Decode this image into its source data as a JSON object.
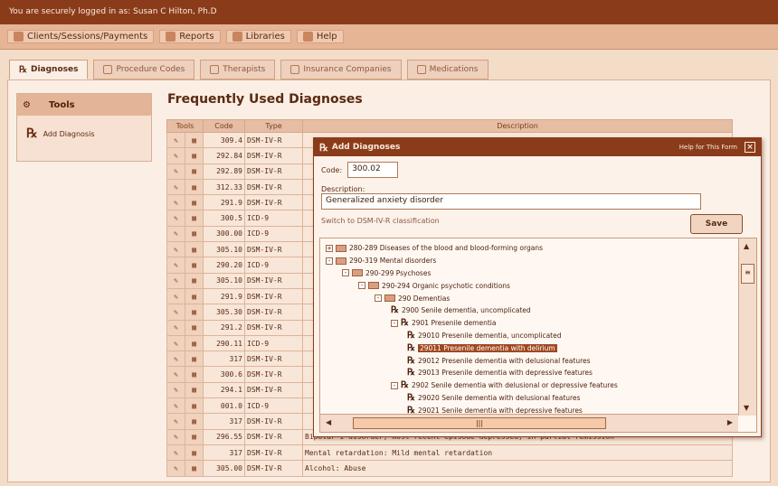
{
  "login_bar": "You are securely logged in as: Susan C Hilton, Ph.D",
  "menu": [
    "Clients/Sessions/Payments",
    "Reports",
    "Libraries",
    "Help"
  ],
  "tabs": [
    "Diagnoses",
    "Procedure Codes",
    "Therapists",
    "Insurance Companies",
    "Medications"
  ],
  "tools": {
    "title": "Tools",
    "add_label": "Add Diagnosis"
  },
  "frequent_title": "Frequently Used Diagnoses",
  "grid": {
    "headers": [
      "Tools",
      "Code",
      "Type",
      "Description"
    ],
    "rows": [
      {
        "code": "309.4",
        "type": "DSM-IV-R",
        "desc": ""
      },
      {
        "code": "292.84",
        "type": "DSM-IV-R",
        "desc": ""
      },
      {
        "code": "292.89",
        "type": "DSM-IV-R",
        "desc": ""
      },
      {
        "code": "312.33",
        "type": "DSM-IV-R",
        "desc": ""
      },
      {
        "code": "291.9",
        "type": "DSM-IV-R",
        "desc": ""
      },
      {
        "code": "300.5",
        "type": "ICD-9",
        "desc": ""
      },
      {
        "code": "300.00",
        "type": "ICD-9",
        "desc": ""
      },
      {
        "code": "305.10",
        "type": "DSM-IV-R",
        "desc": ""
      },
      {
        "code": "290.20",
        "type": "ICD-9",
        "desc": ""
      },
      {
        "code": "305.10",
        "type": "DSM-IV-R",
        "desc": ""
      },
      {
        "code": "291.9",
        "type": "DSM-IV-R",
        "desc": ""
      },
      {
        "code": "305.30",
        "type": "DSM-IV-R",
        "desc": ""
      },
      {
        "code": "291.2",
        "type": "DSM-IV-R",
        "desc": ""
      },
      {
        "code": "290.11",
        "type": "ICD-9",
        "desc": ""
      },
      {
        "code": "317",
        "type": "DSM-IV-R",
        "desc": ""
      },
      {
        "code": "300.6",
        "type": "DSM-IV-R",
        "desc": ""
      },
      {
        "code": "294.1",
        "type": "DSM-IV-R",
        "desc": ""
      },
      {
        "code": "001.0",
        "type": "ICD-9",
        "desc": ""
      },
      {
        "code": "317",
        "type": "DSM-IV-R",
        "desc": ""
      },
      {
        "code": "296.55",
        "type": "DSM-IV-R",
        "desc": "Bipolar I disorder, most recent episode depressed, in partial remission"
      },
      {
        "code": "317",
        "type": "DSM-IV-R",
        "desc": "Mental retardation: Mild mental retardation"
      },
      {
        "code": "305.00",
        "type": "DSM-IV-R",
        "desc": "Alcohol: Abuse"
      }
    ]
  },
  "dialog": {
    "title": "Add Diagnoses",
    "help_link": "Help for This Form",
    "code_label": "Code:",
    "code_value": "300.02",
    "description_label": "Description:",
    "description_value": "Generalized anxiety disorder",
    "switch_link": "Switch to DSM-IV-R classification",
    "save_label": "Save"
  },
  "tree": [
    {
      "depth": 0,
      "kind": "folder",
      "exp": "+",
      "label": "280-289 Diseases of the blood and blood-forming organs"
    },
    {
      "depth": 0,
      "kind": "folder",
      "exp": "-",
      "label": "290-319 Mental disorders"
    },
    {
      "depth": 1,
      "kind": "folder",
      "exp": "-",
      "label": "290-299 Psychoses"
    },
    {
      "depth": 2,
      "kind": "folder",
      "exp": "-",
      "label": "290-294 Organic psychotic conditions"
    },
    {
      "depth": 3,
      "kind": "folder",
      "exp": "-",
      "label": "290 Dementias"
    },
    {
      "depth": 4,
      "kind": "rx",
      "exp": "",
      "label": "2900 Senile dementia, uncomplicated"
    },
    {
      "depth": 4,
      "kind": "rx",
      "exp": "-",
      "label": "2901 Presenile dementia"
    },
    {
      "depth": 5,
      "kind": "rx",
      "exp": "",
      "label": "29010 Presenile dementia, uncomplicated"
    },
    {
      "depth": 5,
      "kind": "rx",
      "exp": "",
      "label": "29011 Presenile dementia with delirium",
      "selected": true
    },
    {
      "depth": 5,
      "kind": "rx",
      "exp": "",
      "label": "29012 Presenile dementia with delusional features"
    },
    {
      "depth": 5,
      "kind": "rx",
      "exp": "",
      "label": "29013 Presenile dementia with depressive features"
    },
    {
      "depth": 4,
      "kind": "rx",
      "exp": "-",
      "label": "2902 Senile dementia with delusional or depressive features"
    },
    {
      "depth": 5,
      "kind": "rx",
      "exp": "",
      "label": "29020 Senile dementia with delusional features"
    },
    {
      "depth": 5,
      "kind": "rx",
      "exp": "",
      "label": "29021 Senile dementia with depressive features"
    }
  ]
}
